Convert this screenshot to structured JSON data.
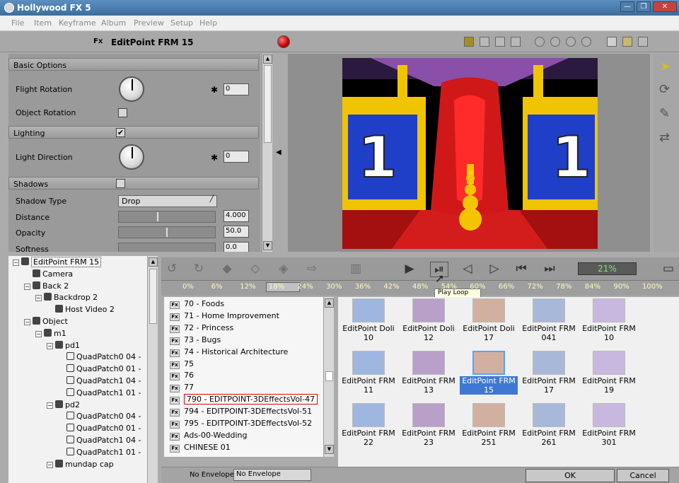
{
  "window": {
    "title": "Hollywood FX 5",
    "controls": [
      "—",
      "❐",
      "✕"
    ]
  },
  "menu": [
    "File",
    "Item",
    "Keyframe",
    "Album",
    "Preview",
    "Setup",
    "Help"
  ],
  "header": {
    "fx_badge": "Fx",
    "title": "EditPoint FRM 15"
  },
  "props": {
    "basic_options": "Basic Options",
    "flight_rotation": {
      "label": "Flight Rotation",
      "value": "0"
    },
    "object_rotation": "Object Rotation",
    "lighting": {
      "label": "Lighting",
      "checked": "✔"
    },
    "light_direction": {
      "label": "Light Direction",
      "value": "0"
    },
    "shadows": "Shadows",
    "shadow_type": {
      "label": "Shadow Type",
      "value": "Drop"
    },
    "distance": {
      "label": "Distance",
      "value": "4.000"
    },
    "opacity": {
      "label": "Opacity",
      "value": "50.0"
    },
    "softness": {
      "label": "Softness",
      "value": "0.0"
    }
  },
  "scene": {
    "digit": "1"
  },
  "tree": [
    {
      "label": "EditPoint FRM 15",
      "depth": 0,
      "toggle": "−",
      "selected": true
    },
    {
      "label": "Camera",
      "depth": 1
    },
    {
      "label": "Back 2",
      "depth": 1,
      "toggle": "−"
    },
    {
      "label": "Backdrop 2",
      "depth": 2,
      "toggle": "−"
    },
    {
      "label": "Host Video 2",
      "depth": 3
    },
    {
      "label": "Object",
      "depth": 1,
      "toggle": "−"
    },
    {
      "label": "m1",
      "depth": 2,
      "toggle": "−"
    },
    {
      "label": "pd1",
      "depth": 3,
      "toggle": "−"
    },
    {
      "label": "QuadPatch0 04 -",
      "depth": 4
    },
    {
      "label": "QuadPatch0 01 -",
      "depth": 4
    },
    {
      "label": "QuadPatch1 04 -",
      "depth": 4
    },
    {
      "label": "QuadPatch1 01 -",
      "depth": 4
    },
    {
      "label": "pd2",
      "depth": 3,
      "toggle": "−"
    },
    {
      "label": "QuadPatch0 04 -",
      "depth": 4
    },
    {
      "label": "QuadPatch0 01 -",
      "depth": 4
    },
    {
      "label": "QuadPatch1 04 -",
      "depth": 4
    },
    {
      "label": "QuadPatch1 01 -",
      "depth": 4
    },
    {
      "label": "mundap cap",
      "depth": 3,
      "toggle": "−"
    }
  ],
  "transport": {
    "percent": "21%"
  },
  "timeline": [
    "0%",
    "6%",
    "12%",
    "18%",
    "24%",
    "30%",
    "36%",
    "42%",
    "48%",
    "54%",
    "60%",
    "66%",
    "72%",
    "78%",
    "84%",
    "90%",
    "100%"
  ],
  "tooltip": "Play Loop",
  "album": [
    {
      "label": "70 - Foods"
    },
    {
      "label": "71 - Home Improvement"
    },
    {
      "label": "72 - Princess"
    },
    {
      "label": "73 - Bugs"
    },
    {
      "label": "74 - Historical Architecture"
    },
    {
      "label": "75"
    },
    {
      "label": "76"
    },
    {
      "label": "77"
    },
    {
      "label": "790 - EDITPOINT-3DEffectsVol-47",
      "highlighted": true
    },
    {
      "label": "794 - EDITPOINT-3DEffectsVol-51"
    },
    {
      "label": "795 - EDITPOINT-3DEffectsVol-52"
    },
    {
      "label": "Ads-00-Wedding"
    },
    {
      "label": "CHINESE 01"
    }
  ],
  "thumbs": [
    {
      "l1": "EditPoint Doli 10",
      "l2": ""
    },
    {
      "l1": "EditPoint Doli 12",
      "l2": ""
    },
    {
      "l1": "EditPoint Doli 17",
      "l2": ""
    },
    {
      "l1": "EditPoint FRM",
      "l2": "041"
    },
    {
      "l1": "EditPoint FRM",
      "l2": "10"
    },
    {
      "l1": "EditPoint FRM",
      "l2": "11"
    },
    {
      "l1": "EditPoint FRM",
      "l2": "13"
    },
    {
      "l1": "EditPoint FRM",
      "l2": "15",
      "selected": true
    },
    {
      "l1": "EditPoint FRM",
      "l2": "17"
    },
    {
      "l1": "EditPoint FRM",
      "l2": "19"
    },
    {
      "l1": "EditPoint FRM",
      "l2": "22"
    },
    {
      "l1": "EditPoint FRM",
      "l2": "23"
    },
    {
      "l1": "EditPoint FRM",
      "l2": "251"
    },
    {
      "l1": "EditPoint FRM",
      "l2": "261"
    },
    {
      "l1": "EditPoint FRM",
      "l2": "301"
    }
  ],
  "bottom": {
    "envelope_label": "No Envelope",
    "envelope_value": "No Envelope",
    "ok": "OK",
    "cancel": "Cancel"
  }
}
